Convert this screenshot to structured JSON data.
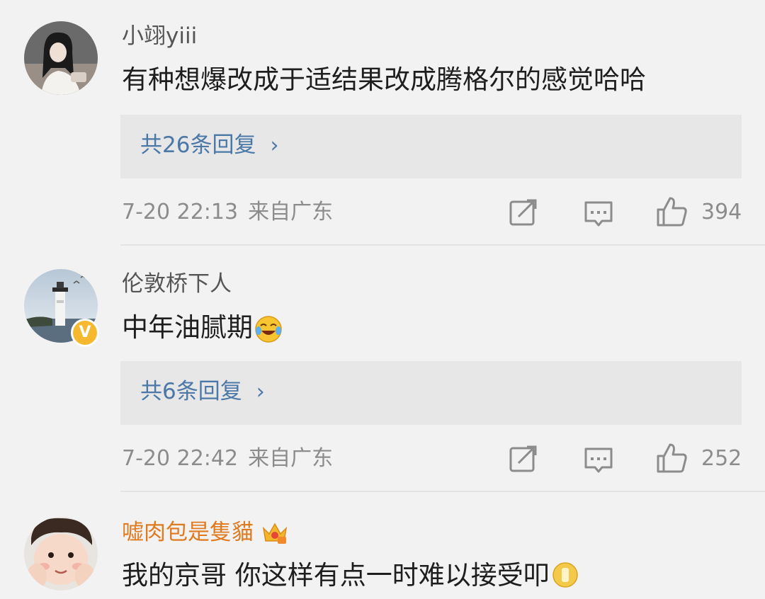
{
  "comments": [
    {
      "username": "小翊yiii",
      "content": "有种想爆改成于适结果改成腾格尔的感觉哈哈",
      "reply_text": "共26条回复",
      "time": "7-20 22:13",
      "location": "来自广东",
      "likes": "394"
    },
    {
      "username": "伦敦桥下人",
      "content": "中年油腻期",
      "content_emoji": "laugh-cry-emoji",
      "verified_badge": "V",
      "reply_text": "共6条回复",
      "time": "7-20 22:42",
      "location": "来自广东",
      "likes": "252"
    },
    {
      "username": "嘘肉包是隻貓",
      "username_color": "#e07a1f",
      "username_badge_icon": "crown-icon",
      "content": "我的京哥 你这样有点一时难以接受叩"
    }
  ],
  "colors": {
    "link": "#4c78a8",
    "meta": "#8c8c8c",
    "badge": "#f5b82e"
  }
}
